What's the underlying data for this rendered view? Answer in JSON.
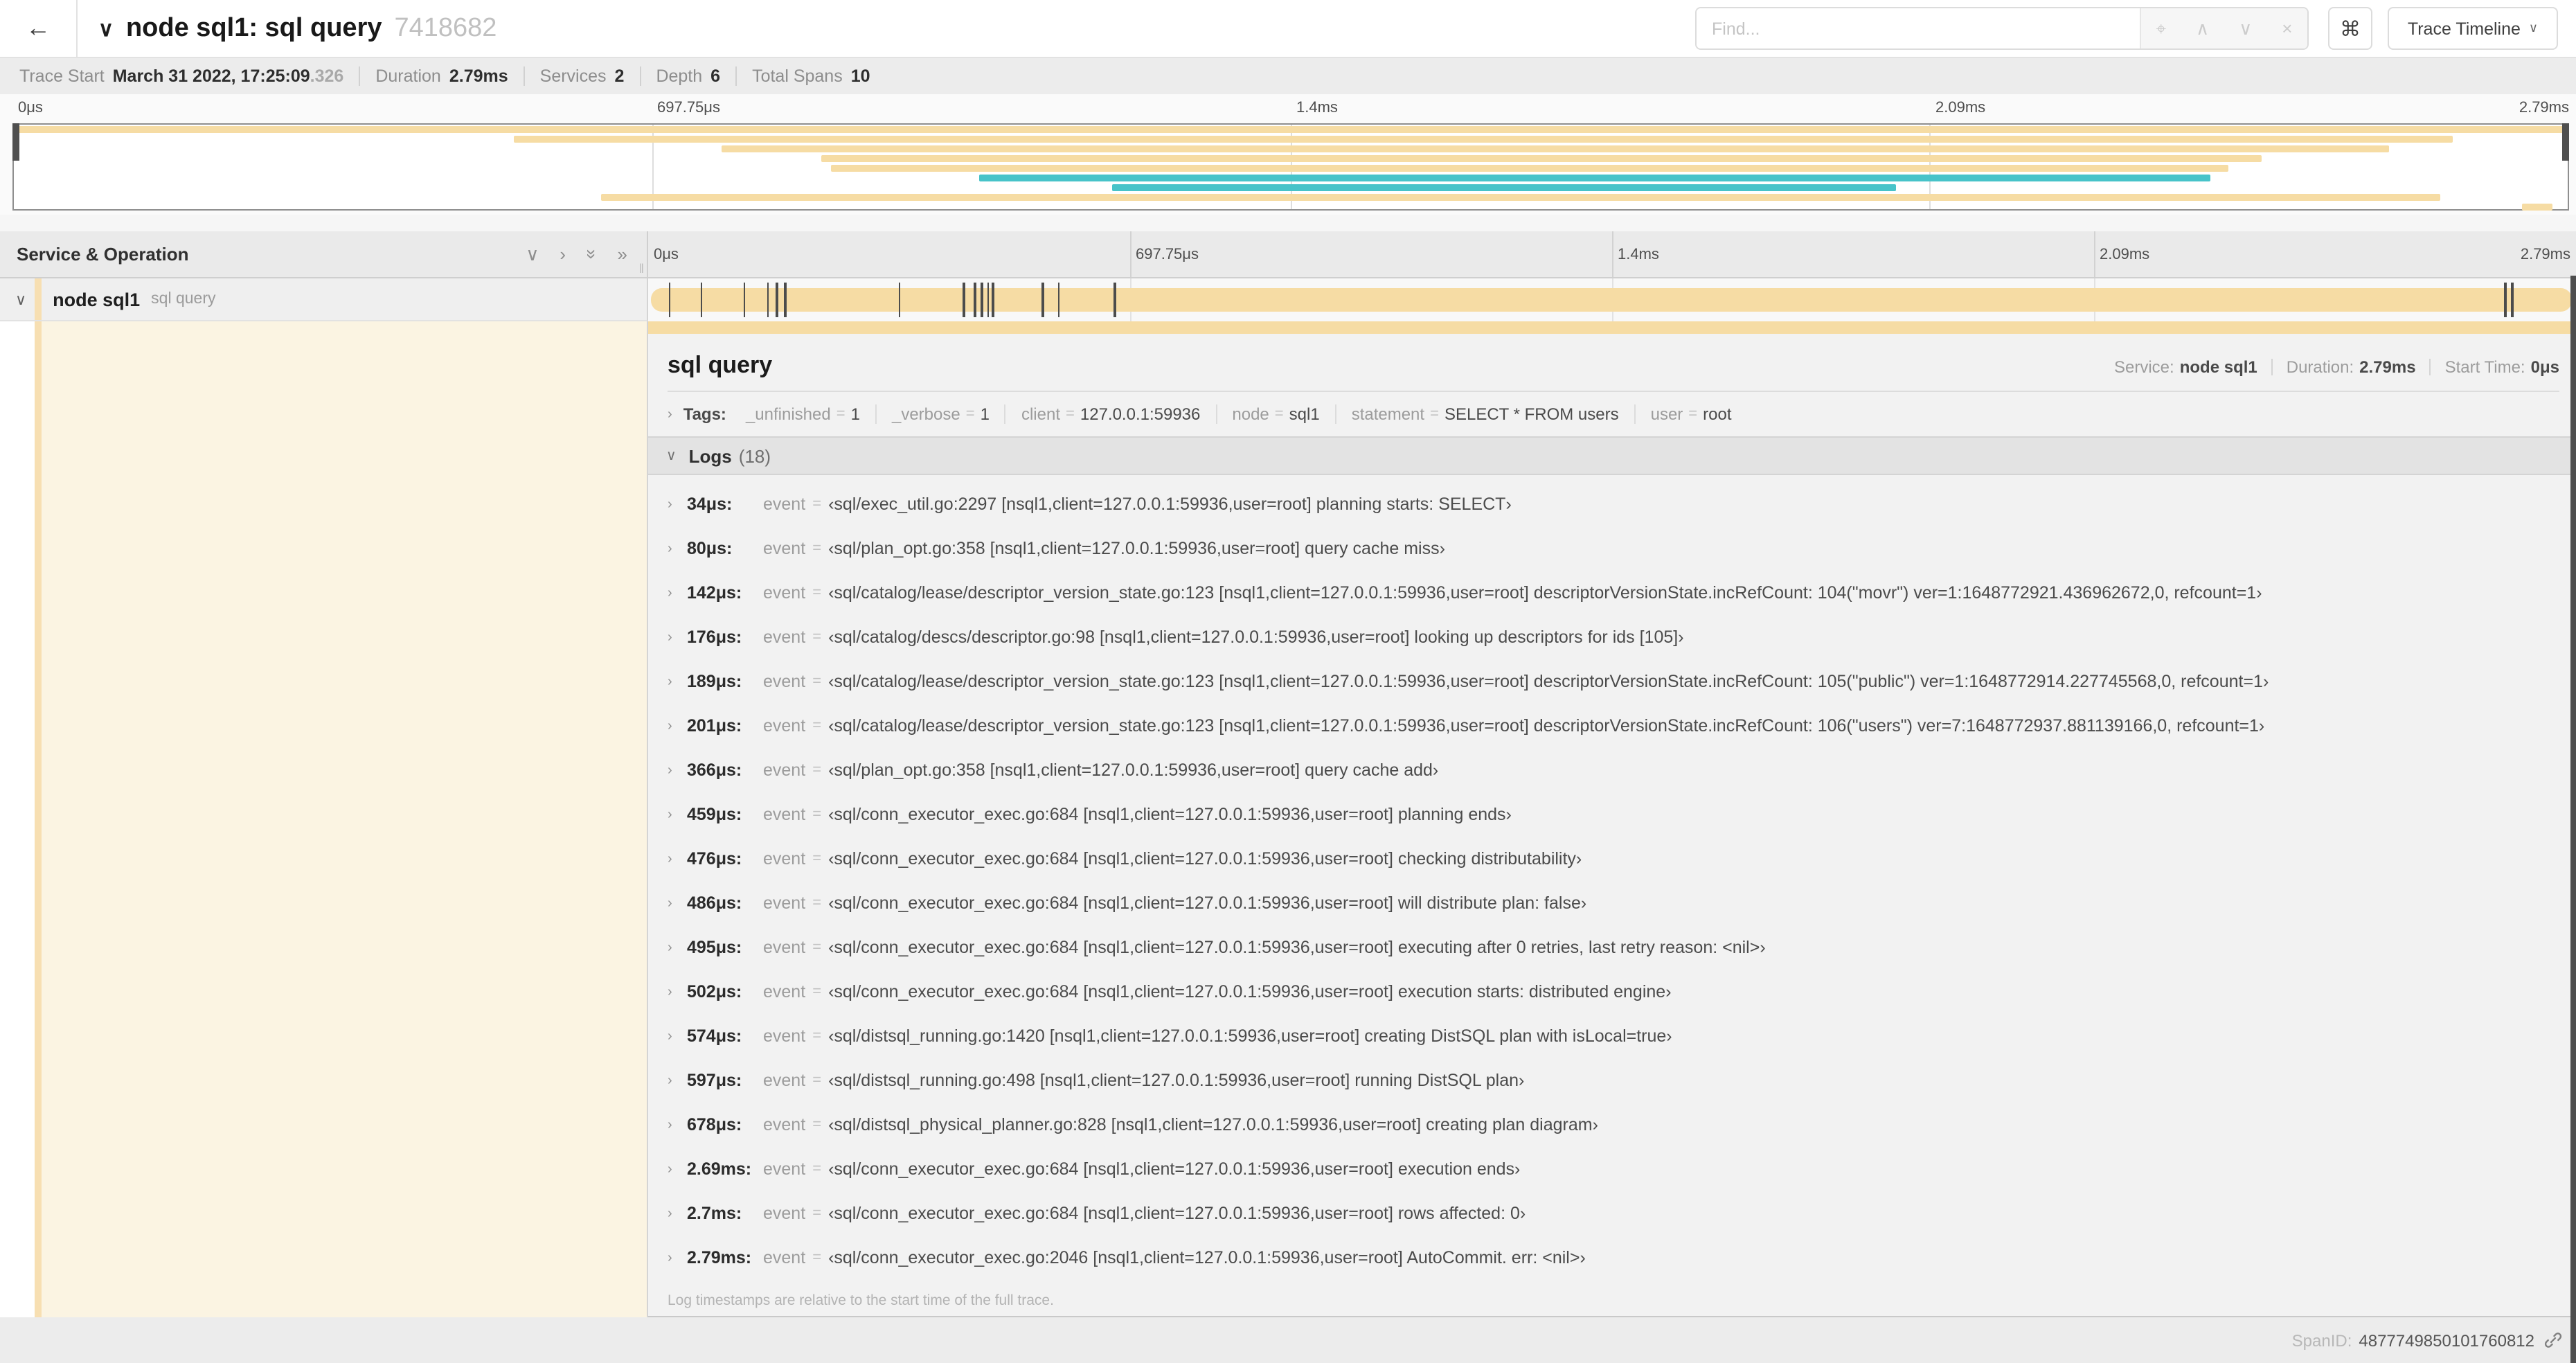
{
  "colors": {
    "tan": "#F6DCA4",
    "teal": "#47C3C9",
    "strip": "#F7DFB2",
    "cream": "#FBF4E2"
  },
  "header": {
    "back_icon": "←",
    "collapse_chevron": "∨",
    "title": "node sql1: sql query",
    "trace_id_short": "7418682",
    "find_placeholder": "Find...",
    "locate_icon": "⌖",
    "prev_icon": "∧",
    "next_icon": "∨",
    "clear_icon": "×",
    "shortcut_icon": "⌘",
    "view_button": "Trace Timeline",
    "dropdown_chevron": "∨"
  },
  "summary": {
    "trace_start_label": "Trace Start",
    "trace_start_value": "March 31 2022, 17:25:09",
    "trace_start_ms": ".326",
    "duration_label": "Duration",
    "duration_value": "2.79ms",
    "services_label": "Services",
    "services_value": "2",
    "depth_label": "Depth",
    "depth_value": "6",
    "total_spans_label": "Total Spans",
    "total_spans_value": "10"
  },
  "timeline": {
    "duration_us": 2790
  },
  "ruler": {
    "ticks": [
      {
        "label": "0μs",
        "pct": 0
      },
      {
        "label": "697.75μs",
        "pct": 25
      },
      {
        "label": "1.4ms",
        "pct": 50
      },
      {
        "label": "2.09ms",
        "pct": 75
      },
      {
        "label": "2.79ms",
        "pct": 100
      }
    ]
  },
  "minimap": {
    "spans": [
      {
        "start": 0.0,
        "end": 1.0,
        "color": "tan"
      },
      {
        "start": 0.196,
        "end": 0.955,
        "color": "tan"
      },
      {
        "start": 0.277,
        "end": 0.93,
        "color": "tan"
      },
      {
        "start": 0.316,
        "end": 0.88,
        "color": "tan"
      },
      {
        "start": 0.32,
        "end": 0.867,
        "color": "tan"
      },
      {
        "start": 0.378,
        "end": 0.86,
        "color": "teal"
      },
      {
        "start": 0.43,
        "end": 0.737,
        "color": "teal"
      },
      {
        "start": 0.23,
        "end": 0.95,
        "color": "tan"
      },
      {
        "start": 0.982,
        "end": 0.994,
        "color": "tan"
      }
    ]
  },
  "sidebar": {
    "header": "Service & Operation",
    "icon_down": "∨",
    "icon_right": "›",
    "icon_double": "»",
    "grip": "‖",
    "row_chevron": "∨",
    "service": "node sql1",
    "operation": "sql query"
  },
  "span_detail": {
    "name": "sql query",
    "service_label": "Service:",
    "service": "node sql1",
    "duration_label": "Duration:",
    "duration": "2.79ms",
    "start_label": "Start Time:",
    "start": "0μs",
    "tags_chevron": "›",
    "tags_label": "Tags:",
    "tags": [
      {
        "key": "_unfinished",
        "value": "1"
      },
      {
        "key": "_verbose",
        "value": "1"
      },
      {
        "key": "client",
        "value": "127.0.0.1:59936"
      },
      {
        "key": "node",
        "value": "sql1"
      },
      {
        "key": "statement",
        "value": "SELECT * FROM users"
      },
      {
        "key": "user",
        "value": "root"
      }
    ],
    "eq": "=",
    "logs_chevron": "∨",
    "logs_label": "Logs",
    "logs_count": "(18)",
    "row_chevron": "›",
    "field_key": "event",
    "rows": [
      {
        "time": "34μs:",
        "us": 34,
        "value": "‹sql/exec_util.go:2297 [nsql1,client=127.0.0.1:59936,user=root] planning starts: SELECT›"
      },
      {
        "time": "80μs:",
        "us": 80,
        "value": "‹sql/plan_opt.go:358 [nsql1,client=127.0.0.1:59936,user=root] query cache miss›"
      },
      {
        "time": "142μs:",
        "us": 142,
        "value": "‹sql/catalog/lease/descriptor_version_state.go:123 [nsql1,client=127.0.0.1:59936,user=root] descriptorVersionState.incRefCount: 104(\"movr\") ver=1:1648772921.436962672,0, refcount=1›"
      },
      {
        "time": "176μs:",
        "us": 176,
        "value": "‹sql/catalog/descs/descriptor.go:98 [nsql1,client=127.0.0.1:59936,user=root] looking up descriptors for ids [105]›"
      },
      {
        "time": "189μs:",
        "us": 189,
        "value": "‹sql/catalog/lease/descriptor_version_state.go:123 [nsql1,client=127.0.0.1:59936,user=root] descriptorVersionState.incRefCount: 105(\"public\") ver=1:1648772914.227745568,0, refcount=1›"
      },
      {
        "time": "201μs:",
        "us": 201,
        "value": "‹sql/catalog/lease/descriptor_version_state.go:123 [nsql1,client=127.0.0.1:59936,user=root] descriptorVersionState.incRefCount: 106(\"users\") ver=7:1648772937.881139166,0, refcount=1›"
      },
      {
        "time": "366μs:",
        "us": 366,
        "value": "‹sql/plan_opt.go:358 [nsql1,client=127.0.0.1:59936,user=root] query cache add›"
      },
      {
        "time": "459μs:",
        "us": 459,
        "value": "‹sql/conn_executor_exec.go:684 [nsql1,client=127.0.0.1:59936,user=root] planning ends›"
      },
      {
        "time": "476μs:",
        "us": 476,
        "value": "‹sql/conn_executor_exec.go:684 [nsql1,client=127.0.0.1:59936,user=root] checking distributability›"
      },
      {
        "time": "486μs:",
        "us": 486,
        "value": "‹sql/conn_executor_exec.go:684 [nsql1,client=127.0.0.1:59936,user=root] will distribute plan: false›"
      },
      {
        "time": "495μs:",
        "us": 495,
        "value": "‹sql/conn_executor_exec.go:684 [nsql1,client=127.0.0.1:59936,user=root] executing after 0 retries, last retry reason: <nil>›"
      },
      {
        "time": "502μs:",
        "us": 502,
        "value": "‹sql/conn_executor_exec.go:684 [nsql1,client=127.0.0.1:59936,user=root] execution starts: distributed engine›"
      },
      {
        "time": "574μs:",
        "us": 574,
        "value": "‹sql/distsql_running.go:1420 [nsql1,client=127.0.0.1:59936,user=root] creating DistSQL plan with isLocal=true›"
      },
      {
        "time": "597μs:",
        "us": 597,
        "value": "‹sql/distsql_running.go:498 [nsql1,client=127.0.0.1:59936,user=root] running DistSQL plan›"
      },
      {
        "time": "678μs:",
        "us": 678,
        "value": "‹sql/distsql_physical_planner.go:828 [nsql1,client=127.0.0.1:59936,user=root] creating plan diagram›"
      },
      {
        "time": "2.69ms:",
        "us": 2690,
        "value": "‹sql/conn_executor_exec.go:684 [nsql1,client=127.0.0.1:59936,user=root] execution ends›"
      },
      {
        "time": "2.7ms:",
        "us": 2700,
        "value": "‹sql/conn_executor_exec.go:684 [nsql1,client=127.0.0.1:59936,user=root] rows affected: 0›"
      },
      {
        "time": "2.79ms:",
        "us": 2790,
        "value": "‹sql/conn_executor_exec.go:2046 [nsql1,client=127.0.0.1:59936,user=root] AutoCommit. err: <nil>›"
      }
    ],
    "note": "Log timestamps are relative to the start time of the full trace.",
    "spanid_label": "SpanID:",
    "spanid": "4877749850101760812"
  }
}
